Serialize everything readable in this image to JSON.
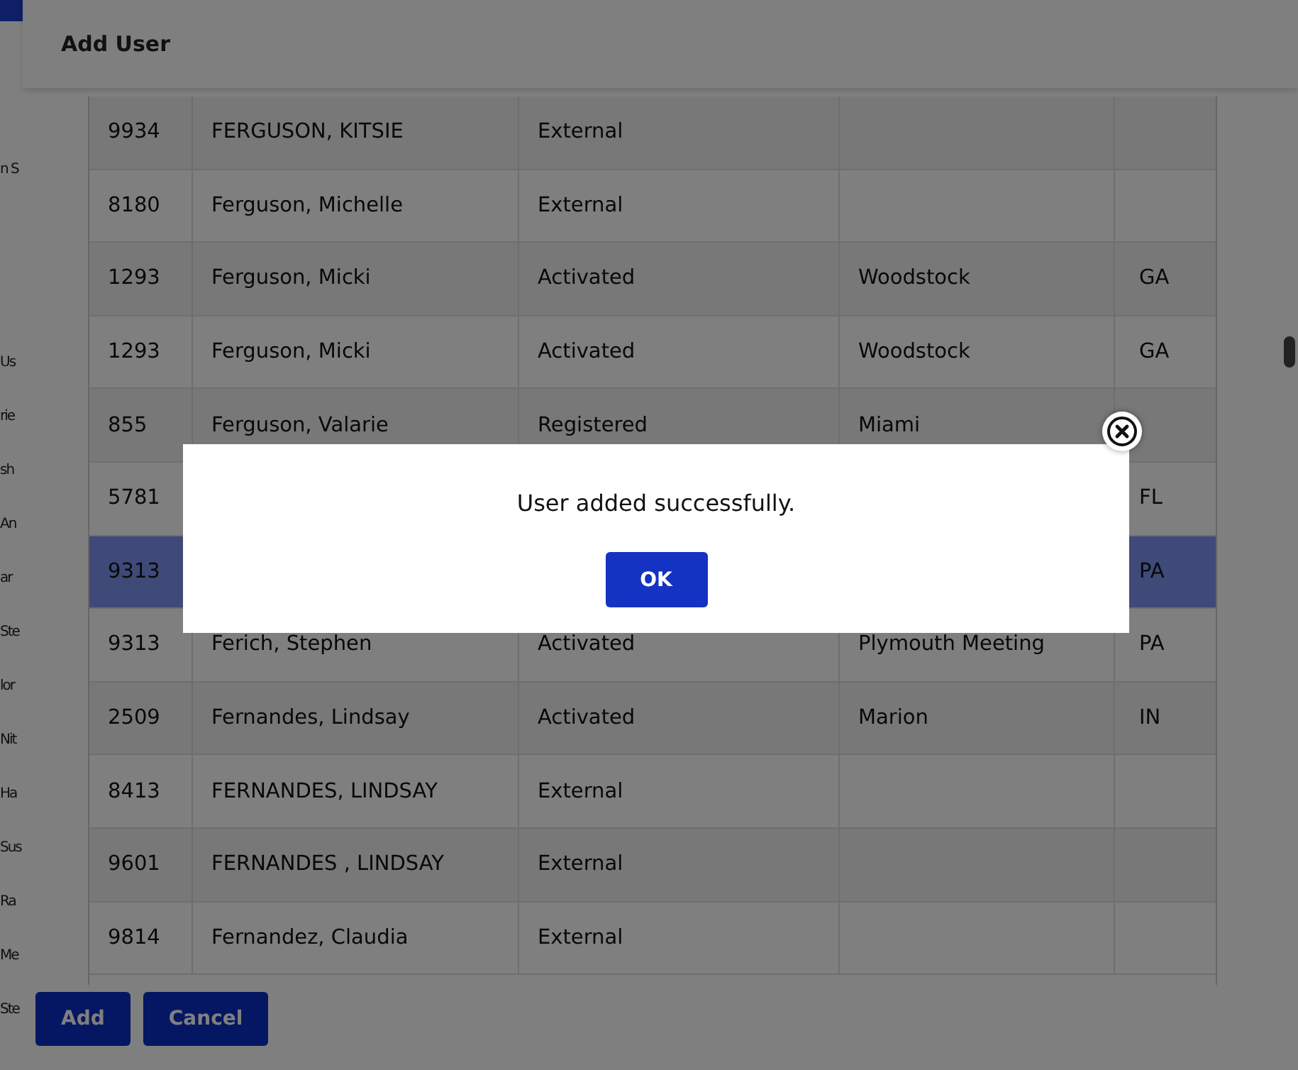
{
  "background_page": {
    "fragments": [
      "n S",
      "Us",
      "rie",
      "sh",
      "An",
      "ar",
      "Ste",
      "lor",
      "Nit",
      "Ha",
      "Sus",
      "Ra",
      "Me",
      "Ste"
    ]
  },
  "modal": {
    "title": "Add User",
    "rows": [
      {
        "id": "9934",
        "name": "FERGUSON, KITSIE",
        "status": "External",
        "selected": false
      },
      {
        "id": "8180",
        "name": "Ferguson, Michelle",
        "status": "External",
        "selected": false
      },
      {
        "id": "1293",
        "name": "Ferguson, Micki",
        "status": "Activated",
        "city": "Woodstock",
        "state": "GA",
        "selected": false
      },
      {
        "id": "1293",
        "name": "Ferguson, Micki",
        "status": "Activated",
        "city": "Woodstock",
        "state": "GA",
        "selected": false
      },
      {
        "id": "855",
        "name": "Ferguson, Valarie",
        "status": "Registered",
        "city": "Miami",
        "selected": false
      },
      {
        "id": "5781",
        "state": "FL",
        "selected": false
      },
      {
        "id": "9313",
        "state": "PA",
        "selected": true
      },
      {
        "id": "9313",
        "name": "Ferich, Stephen",
        "status": "Activated",
        "city": "Plymouth Meeting",
        "state": "PA",
        "selected": false
      },
      {
        "id": "2509",
        "name": "Fernandes, Lindsay",
        "status": "Activated",
        "city": "Marion",
        "state": "IN",
        "selected": false
      },
      {
        "id": "8413",
        "name": "FERNANDES, LINDSAY",
        "status": "External",
        "selected": false
      },
      {
        "id": "9601",
        "name": "FERNANDES , LINDSAY",
        "status": "External",
        "selected": false
      },
      {
        "id": "9814",
        "name": "Fernandez, Claudia",
        "status": "External",
        "selected": false
      }
    ],
    "buttons": [
      "Add",
      "Cancel"
    ]
  },
  "alert": {
    "message": "User added successfully.",
    "button": "OK"
  }
}
